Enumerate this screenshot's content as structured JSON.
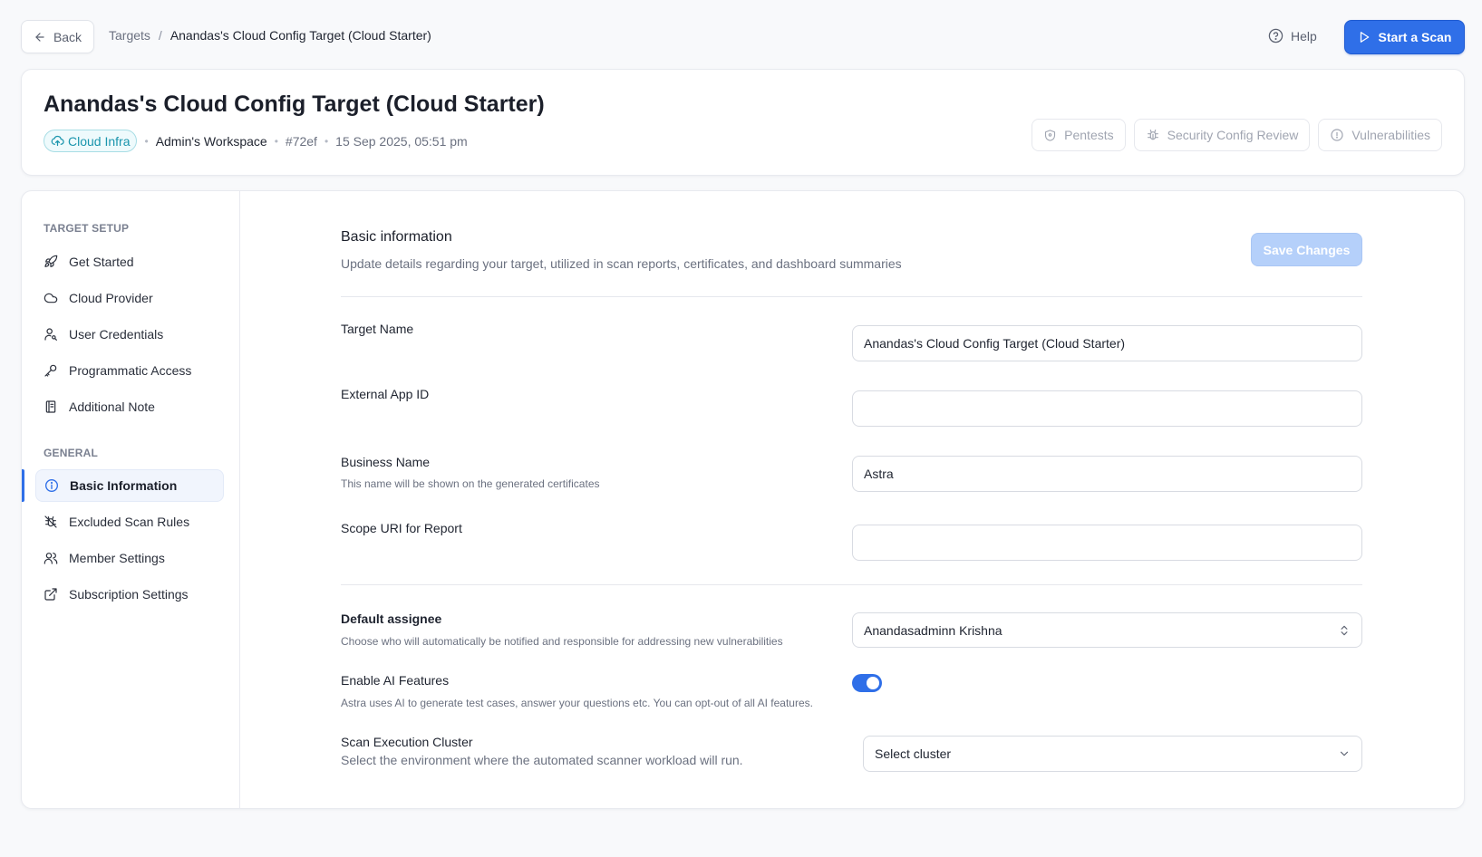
{
  "topbar": {
    "back_label": "Back",
    "breadcrumb": [
      "Targets",
      "Anandas's Cloud Config Target (Cloud Starter)"
    ],
    "breadcrumb_sep": "/",
    "help_label": "Help",
    "start_scan_label": "Start a Scan"
  },
  "header": {
    "title": "Anandas's Cloud Config Target (Cloud Starter)",
    "badge": "Cloud Infra",
    "workspace": "Admin's Workspace",
    "target_id": "#72ef",
    "created": "15 Sep 2025, 05:51 pm",
    "dot": "•",
    "tabs": [
      "Pentests",
      "Security Config Review",
      "Vulnerabilities"
    ]
  },
  "sidebar": {
    "setup_heading": "TARGET SETUP",
    "setup_items": [
      {
        "label": "Get Started",
        "icon": "rocket-icon"
      },
      {
        "label": "Cloud Provider",
        "icon": "cloud-icon"
      },
      {
        "label": "User Credentials",
        "icon": "user-key-icon"
      },
      {
        "label": "Programmatic Access",
        "icon": "key-icon"
      },
      {
        "label": "Additional Note",
        "icon": "notebook-icon"
      }
    ],
    "general_heading": "GENERAL",
    "general_items": [
      {
        "label": "Basic Information",
        "icon": "info-icon",
        "active": true
      },
      {
        "label": "Excluded Scan Rules",
        "icon": "bug-off-icon"
      },
      {
        "label": "Member Settings",
        "icon": "users-icon"
      },
      {
        "label": "Subscription Settings",
        "icon": "external-link-icon"
      }
    ]
  },
  "form": {
    "title": "Basic information",
    "subtitle": "Update details regarding your target, utilized in scan reports, certificates, and dashboard summaries",
    "save_label": "Save Changes",
    "target_name_label": "Target Name",
    "target_name_value": "Anandas's Cloud Config Target (Cloud Starter)",
    "external_app_id_label": "External App ID",
    "external_app_id_value": "",
    "business_name_label": "Business Name",
    "business_name_help": "This name will be shown on the generated certificates",
    "business_name_value": "Astra",
    "scope_uri_label": "Scope URI for Report",
    "scope_uri_value": "",
    "default_assignee_label": "Default assignee",
    "default_assignee_help": "Choose who will automatically be notified and responsible for addressing new vulnerabilities",
    "default_assignee_value": "Anandasadminn Krishna",
    "ai_label": "Enable AI Features",
    "ai_help": "Astra uses AI to generate test cases, answer your questions etc. You can opt-out of all AI features.",
    "ai_enabled": true,
    "cluster_label": "Scan Execution Cluster",
    "cluster_help": "Select the environment where the automated scanner workload will run.",
    "cluster_value": "Select cluster"
  },
  "colors": {
    "primary": "#2f6fe8",
    "save_disabled": "#b5d0fa",
    "badge_text": "#1a95ad",
    "badge_bg": "#eefafc"
  }
}
